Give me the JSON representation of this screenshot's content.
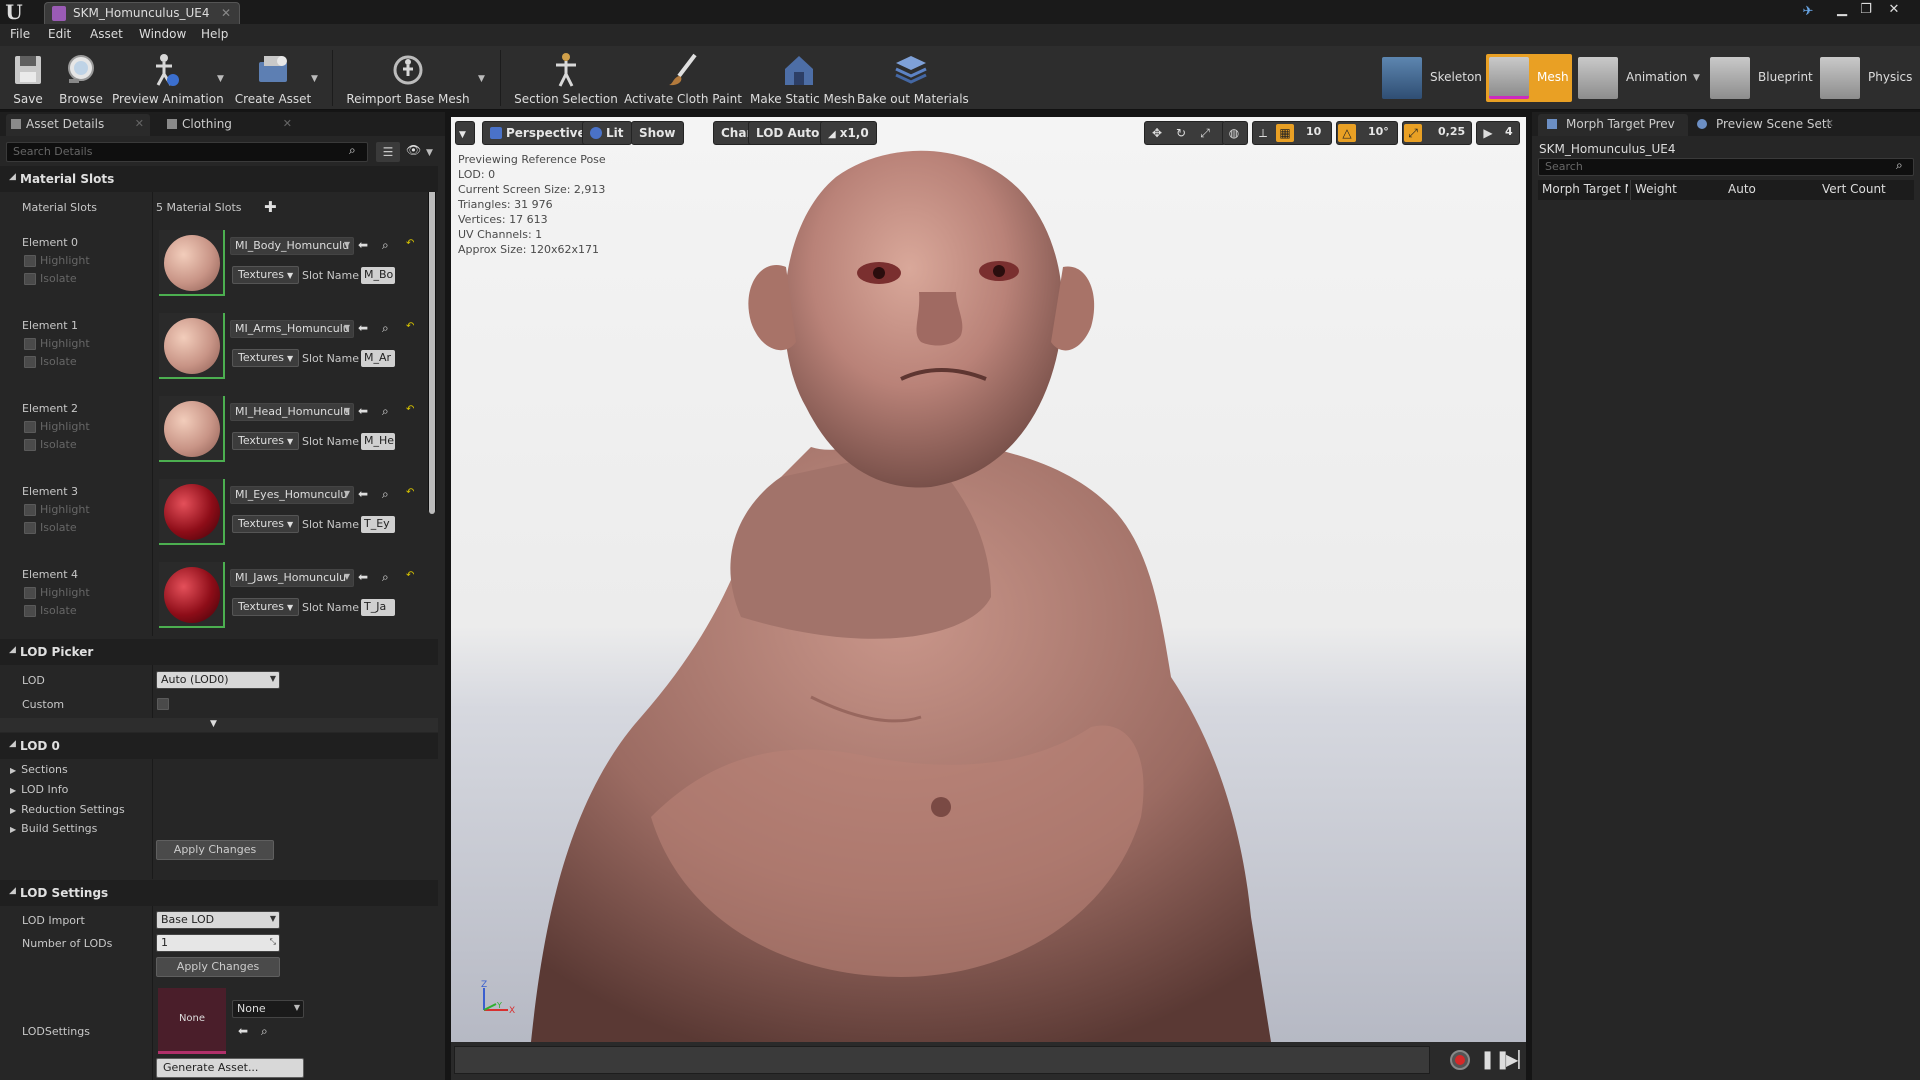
{
  "window": {
    "tab_title": "SKM_Homunculus_UE4"
  },
  "menu": [
    "File",
    "Edit",
    "Asset",
    "Window",
    "Help"
  ],
  "toolbar": {
    "buttons": [
      "Save",
      "Browse",
      "Preview Animation",
      "Create Asset",
      "Reimport Base Mesh",
      "Section Selection",
      "Activate Cloth Paint",
      "Make Static Mesh",
      "Bake out Materials"
    ],
    "modes": [
      "Skeleton",
      "Mesh",
      "Animation",
      "Blueprint",
      "Physics"
    ],
    "active_mode": "Mesh"
  },
  "left_tabs": [
    "Asset Details",
    "Clothing"
  ],
  "details": {
    "search_placeholder": "Search Details",
    "material_slots": {
      "header": "Material Slots",
      "label": "Material Slots",
      "count_text": "5 Material Slots",
      "elements": [
        {
          "label": "Element 0",
          "material": "MI_Body_Homunculu",
          "slot_value": "M_Bo",
          "thumb": "skin"
        },
        {
          "label": "Element 1",
          "material": "MI_Arms_Homunculu",
          "slot_value": "M_Ar",
          "thumb": "skin"
        },
        {
          "label": "Element 2",
          "material": "MI_Head_Homunculu",
          "slot_value": "M_He",
          "thumb": "skin"
        },
        {
          "label": "Element 3",
          "material": "MI_Eyes_Homunculu",
          "slot_value": "T_Ey",
          "thumb": "red"
        },
        {
          "label": "Element 4",
          "material": "MI_Jaws_Homunculu",
          "slot_value": "T_Ja",
          "thumb": "red"
        }
      ],
      "highlight_label": "Highlight",
      "isolate_label": "Isolate",
      "textures_label": "Textures",
      "slot_name_label": "Slot Name"
    },
    "lod_picker": {
      "header": "LOD Picker",
      "lod_label": "LOD",
      "lod_value": "Auto (LOD0)",
      "custom_label": "Custom"
    },
    "lod0": {
      "header": "LOD 0",
      "items": [
        "Sections",
        "LOD Info",
        "Reduction Settings",
        "Build Settings"
      ],
      "apply_label": "Apply Changes"
    },
    "lod_settings": {
      "header": "LOD Settings",
      "lod_import_label": "LOD Import",
      "lod_import_value": "Base LOD",
      "num_lods_label": "Number of LODs",
      "num_lods_value": "1",
      "apply_label": "Apply Changes",
      "lodsettings_label": "LODSettings",
      "asset_thumb_text": "None",
      "asset_combo": "None",
      "generate_label": "Generate Asset..."
    }
  },
  "viewport": {
    "perspective": "Perspective",
    "lit": "Lit",
    "show": "Show",
    "character": "Character",
    "lod": "LOD Auto",
    "speed": "x1,0",
    "grid_snap": "10",
    "rot_snap": "10°",
    "scale_snap": "0,25",
    "cam_speed": "4",
    "stats": [
      "Previewing Reference Pose",
      "LOD: 0",
      "Current Screen Size: 2,913",
      "Triangles: 31 976",
      "Vertices: 17 613",
      "UV Channels: 1",
      "Approx Size: 120x62x171"
    ],
    "axis": {
      "z": "Z",
      "y": "Y",
      "x": "X"
    }
  },
  "right_tabs": [
    "Morph Target Prev",
    "Preview Scene Sett"
  ],
  "morph": {
    "asset_name": "SKM_Homunculus_UE4",
    "search_placeholder": "Search",
    "columns": [
      "Morph Target N",
      "Weight",
      "Auto",
      "Vert Count"
    ]
  },
  "colors": {
    "accent_orange": "#e9a024",
    "mesh_mode_bg": "#e9a024",
    "thumb_border": "#4caf50",
    "record_red": "#d62828"
  }
}
